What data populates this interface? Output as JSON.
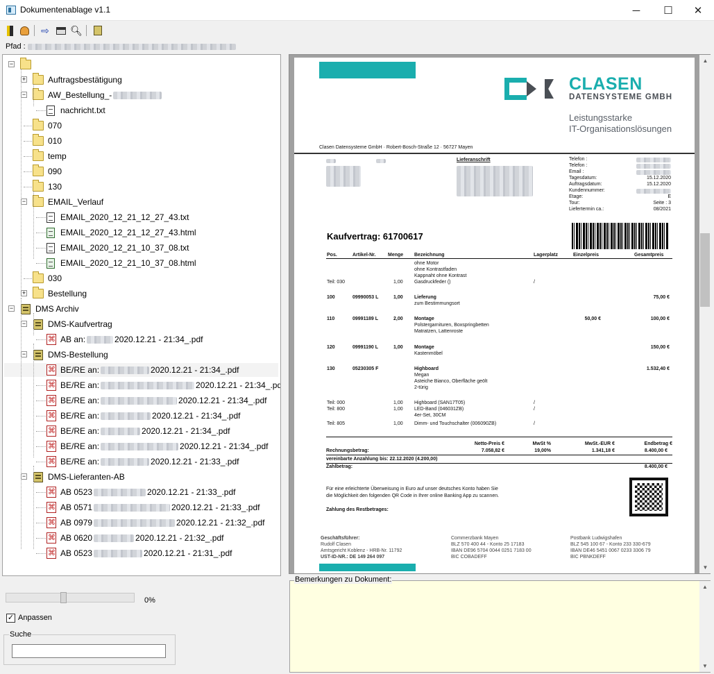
{
  "window": {
    "title": "Dokumentenablage v1.1",
    "minimize": "─",
    "maximize": "☐",
    "close": "✕"
  },
  "toolbar": {
    "icons": [
      "exit-icon",
      "user-icon",
      "import-icon",
      "print-icon",
      "search-icon",
      "archive-icon"
    ]
  },
  "path": {
    "label": "Pfad :"
  },
  "tree": {
    "folders": [
      "Auftragsbestätigung",
      "AW_Bestellung_-",
      "nachricht.txt",
      "070",
      "010",
      "temp",
      "090",
      "130",
      "EMAIL_Verlauf",
      "EMAIL_2020_12_21_12_27_43.txt",
      "EMAIL_2020_12_21_12_27_43.html",
      "EMAIL_2020_12_21_10_37_08.txt",
      "EMAIL_2020_12_21_10_37_08.html",
      "030",
      "Bestellung",
      "DMS Archiv",
      "DMS-Kaufvertrag",
      "AB an:",
      "2020.12.21 - 21:34_.pdf",
      "DMS-Bestellung"
    ],
    "bere": [
      "BE/RE an:",
      "2020.12.21 - 21:34_.pdf",
      "2020.12.21 - 21:34_.pdf",
      "2020.12.21 - 21:34_.pdf",
      "2020.12.21 - 21:34_.pdf",
      "2020.12.21 - 21:34_.pdf",
      "2020.12.21 - 21:34_.pdf",
      "2020.12.21 - 21:33_.pdf"
    ],
    "lief": "DMS-Lieferanten-AB",
    "ab": [
      "AB 0523",
      "2020.12.21 - 21:33_.pdf",
      "AB 0571",
      "2020.12.21 - 21:33_.pdf",
      "AB 0979",
      "2020.12.21 - 21:32_.pdf",
      "AB 0620",
      "2020.12.21 - 21:32_.pdf",
      "AB 0523",
      "2020.12.21 - 21:31_.pdf"
    ]
  },
  "zoom": {
    "value": "0%",
    "level": 0.45
  },
  "fit": {
    "label": "Anpassen",
    "checked": "✓"
  },
  "search": {
    "label": "Suche",
    "value": ""
  },
  "remarks": {
    "label": "Bemerkungen zu Dokument:"
  },
  "doc": {
    "logo1": "CLASEN",
    "logo2": "DATENSYSTEME GMBH",
    "slogan1": "Leistungsstarke",
    "slogan2": "IT-Organisationslösungen",
    "sender": "Clasen Datensysteme GmbH · Robert-Bosch-Straße 12 · 56727 Mayen",
    "lieferanschrift": "Lieferanschrift",
    "meta_labels": [
      "Telefon :",
      "Telefon :",
      "Email :",
      "Tagesdatum:",
      "Auftragsdatum:",
      "Kundennummer:",
      "Etage:",
      "Tour:",
      "Liefertermin ca.:"
    ],
    "meta_values": [
      "",
      "",
      "",
      "15.12.2020",
      "15.12.2020",
      "",
      "E",
      "Seite :    3",
      "08/2021"
    ],
    "title": "Kaufvertrag:  61700617",
    "cols": [
      "Pos.",
      "Artikel-Nr.",
      "Menge",
      "Bezeichnung",
      "Lagerplatz",
      "Einzelpreis",
      "Gesamtpreis"
    ],
    "lines": [
      [
        "",
        "",
        "",
        "ohne Motor",
        "",
        "",
        ""
      ],
      [
        "",
        "",
        "",
        "ohne Kontrastfaden",
        "",
        "",
        ""
      ],
      [
        "",
        "",
        "",
        "Kappnaht ohne Kontrast",
        "",
        "",
        ""
      ],
      [
        "Teil: 030",
        "",
        "1,00",
        "Gasdruckfeder ()",
        "/",
        "",
        ""
      ],
      [
        "100",
        "09990053 L",
        "1,00",
        "Lieferung",
        "",
        "",
        "75,00 €"
      ],
      [
        "",
        "",
        "",
        "zum Bestimmungsort",
        "",
        "",
        ""
      ],
      [
        "110",
        "09991189 L",
        "2,00",
        "Montage",
        "",
        "50,00 €",
        "100,00 €"
      ],
      [
        "",
        "",
        "",
        "Polstergarnituren, Boxspringbetten",
        "",
        "",
        ""
      ],
      [
        "",
        "",
        "",
        "Matratzen, Lattenroste",
        "",
        "",
        ""
      ],
      [
        "120",
        "09991190 L",
        "1,00",
        "Montage",
        "",
        "",
        "150,00 €"
      ],
      [
        "",
        "",
        "",
        "Kastenmöbel",
        "",
        "",
        ""
      ],
      [
        "130",
        "05230305 F",
        "",
        "Highboard",
        "",
        "",
        "1.532,40 €"
      ],
      [
        "",
        "",
        "",
        "Megan",
        "",
        "",
        ""
      ],
      [
        "",
        "",
        "",
        "Asteiche Bianco, Oberfläche geölt",
        "",
        "",
        ""
      ],
      [
        "",
        "",
        "",
        "2-türig",
        "",
        "",
        ""
      ],
      [
        "Teil: 000",
        "",
        "1,00",
        "Highboard (SAN17T05)",
        "/",
        "",
        ""
      ],
      [
        "Teil: 800",
        "",
        "1,00",
        "LED-Band (046031ZB)",
        "/",
        "",
        ""
      ],
      [
        "",
        "",
        "",
        "4er-Set, 30CM",
        "",
        "",
        ""
      ],
      [
        "Teil: 805",
        "",
        "1,00",
        "Dimm- und Touchschalter (006090ZB)",
        "/",
        "",
        ""
      ]
    ],
    "sum_head": [
      "Netto-Preis  €",
      "MwSt %",
      "MwSt.-EUR €",
      "Endbetrag €"
    ],
    "sum_label": "Rechnungsbetrag:",
    "sum_vals": [
      "7.058,82 €",
      "19,00%",
      "1.341,18 €",
      "8.400,00 €"
    ],
    "anzahlung": "vereinbarte  Anzahlung  bis:  22.12.2020  (4.200,00)",
    "zahlbetrag": "Zahlbetrag:",
    "zahlbetrag_val": "8.400,00 €",
    "qr1": "Für eine erleichterte Überweisung in Euro auf unser deutsches Konto haben Sie",
    "qr2": "die Möglichkeit den folgenden QR Code in Ihrer online Banking App zu scannen.",
    "rest": "Zahlung  des  Restbetrages:",
    "f1": [
      "Geschäftsführer:",
      "Rudolf Clasen",
      "Amtsgericht Koblenz - HRB-Nr. 11792",
      "UST-ID-NR.: DE 149 264 097"
    ],
    "f2": [
      "Commerzbank Mayen",
      "BLZ 570 400 44 - Konto 25 17183",
      "IBAN DE96 5704 0044 0251 7183 00",
      "BIC COBADEFF"
    ],
    "f3": [
      "Postbank Ludwigshafen",
      "BLZ 545 100 67 - Konto 233 330-679",
      "IBAN DE46 5451 0067 0233 3306 79",
      "BIC PBNKDEFF"
    ]
  },
  "colors": {
    "accent": "#1aaeae",
    "logo_dark": "#4a4f55",
    "remarks_bg": "#ffffe1"
  }
}
